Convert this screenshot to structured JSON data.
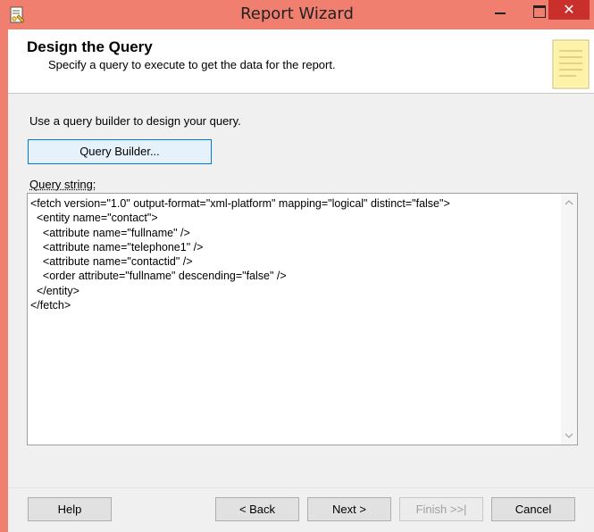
{
  "window": {
    "title": "Report Wizard",
    "controls": {
      "close_glyph": "✕"
    }
  },
  "header": {
    "title": "Design the Query",
    "subtitle": "Specify a query to execute to get the data for the report."
  },
  "body": {
    "instruction": "Use a query builder to design your query.",
    "query_builder_label": "Query Builder...",
    "query_string_label": "Query string:",
    "query_string": "<fetch version=\"1.0\" output-format=\"xml-platform\" mapping=\"logical\" distinct=\"false\">\n  <entity name=\"contact\">\n    <attribute name=\"fullname\" />\n    <attribute name=\"telephone1\" />\n    <attribute name=\"contactid\" />\n    <order attribute=\"fullname\" descending=\"false\" />\n  </entity>\n</fetch>"
  },
  "footer": {
    "help_label": "Help",
    "back_label": "< Back",
    "next_label": "Next >",
    "finish_label": "Finish >>|",
    "cancel_label": "Cancel"
  },
  "icons": {
    "app": "report-wizard-icon",
    "header": "notepad-icon",
    "scroll_up": "chevron-up-icon",
    "scroll_down": "chevron-down-icon"
  },
  "colors": {
    "titlebar": "#f07f6f",
    "close_button": "#c9302c",
    "focus_border": "#0078d7"
  }
}
